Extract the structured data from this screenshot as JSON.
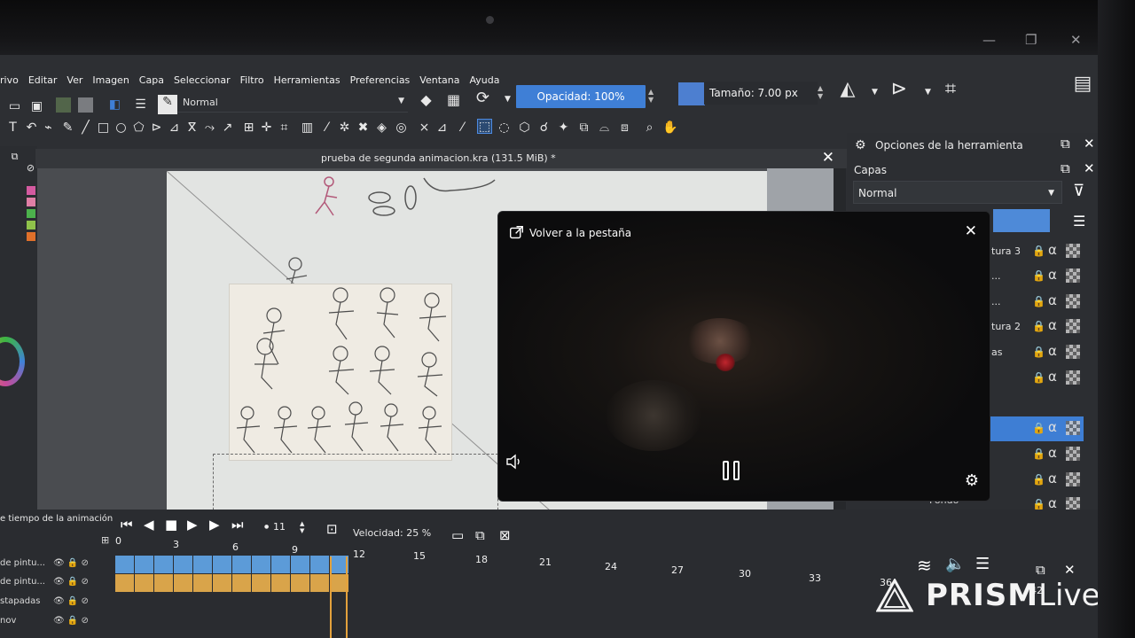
{
  "window": {
    "minimize": "—",
    "maximize": "❐",
    "close": "✕"
  },
  "menu": [
    "rivo",
    "Editar",
    "Ver",
    "Imagen",
    "Capa",
    "Seleccionar",
    "Filtro",
    "Herramientas",
    "Preferencias",
    "Ventana",
    "Ayuda"
  ],
  "toolbar": {
    "blend_mode": "Normal",
    "opacity_label": "Opacidad: 100%",
    "size_label": "Tamaño: 7.00 px",
    "brush_color": "#4d7fd0"
  },
  "document": {
    "title": "prueba de segunda animacion.kra (131.5 MiB) *"
  },
  "color_chips": [
    "#d45aa0",
    "#e07fa6",
    "#4cb24c",
    "#8fc24a",
    "#e0702a"
  ],
  "pip": {
    "return_label": "Volver a la pestaña",
    "close_icon": "close-icon",
    "volume_icon": "volume-icon",
    "pause_icon": "pause-icon",
    "settings_icon": "gear-icon"
  },
  "right_dock": {
    "tool_options_title": "Opciones de la herramienta",
    "layers_title": "Capas",
    "layer_blend": "Normal",
    "layers": [
      {
        "name": "tura 3",
        "selected": false
      },
      {
        "name": "...",
        "selected": false
      },
      {
        "name": "...",
        "selected": false
      },
      {
        "name": "tura 2",
        "selected": false
      },
      {
        "name": "as",
        "selected": false
      },
      {
        "name": "",
        "selected": false
      },
      {
        "name": "",
        "selected": true
      },
      {
        "name": "",
        "selected": false
      },
      {
        "name": "",
        "selected": false
      },
      {
        "name": "",
        "selected": false
      }
    ],
    "bottom_label": "Fondo"
  },
  "timeline": {
    "title": "e tiempo de la animación",
    "current_frame": "11",
    "speed_label": "Velocidad: 25 %",
    "ruler": [
      "0",
      "3",
      "6",
      "9",
      "12",
      "15",
      "18",
      "21",
      "24",
      "27",
      "30",
      "33",
      "36",
      "42"
    ],
    "tracks": [
      {
        "name": "de pintu...",
        "color": "blue",
        "frames": 12
      },
      {
        "name": "de pintu...",
        "color": "orange",
        "frames": 12
      },
      {
        "name": "stapadas",
        "color": "none",
        "frames": 0
      },
      {
        "name": "nov",
        "color": "none",
        "frames": 0
      }
    ]
  },
  "watermark": {
    "brand": "PRISM",
    "brand2": "Live"
  }
}
